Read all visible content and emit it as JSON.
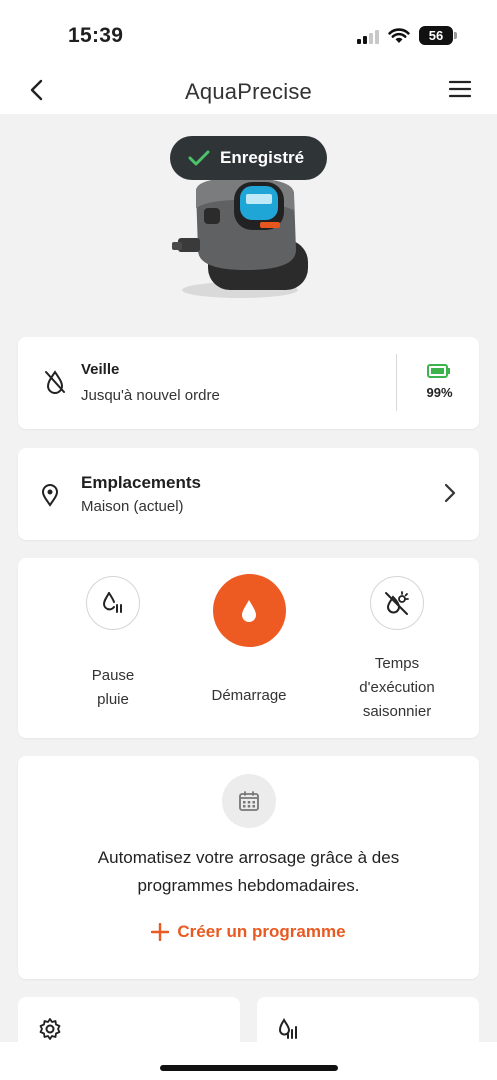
{
  "status_bar": {
    "time": "15:39",
    "battery": "56"
  },
  "nav": {
    "title": "AquaPrecise",
    "back_icon": "chevron-left-icon",
    "menu_icon": "hamburger-menu-icon"
  },
  "device": {
    "badge": "Enregistré",
    "badge_icon": "check-icon"
  },
  "status": {
    "title": "Veille",
    "subtitle": "Jusqu'à nouvel ordre",
    "battery_percent": "99%",
    "battery_color": "#3cb44b"
  },
  "location": {
    "title": "Emplacements",
    "subtitle": "Maison (actuel)"
  },
  "actions": {
    "pause": {
      "label_line1": "Pause",
      "label_line2": "pluie",
      "icon": "rain-pause-icon"
    },
    "start": {
      "label": "Démarrage",
      "icon": "water-drop-icon",
      "color": "#ee5b22"
    },
    "seasonal": {
      "label_line1": "Temps",
      "label_line2": "d'exécution",
      "label_line3": "saisonnier",
      "icon": "seasonal-off-icon"
    }
  },
  "program": {
    "text_line1": "Automatisez votre arrosage grâce à des",
    "text_line2": "programmes hebdomadaires.",
    "create_label": "Créer un programme",
    "accent": "#e85a21"
  },
  "bottom_cards": {
    "left_icon": "settings-gear-icon",
    "right_icon": "water-level-icon"
  }
}
